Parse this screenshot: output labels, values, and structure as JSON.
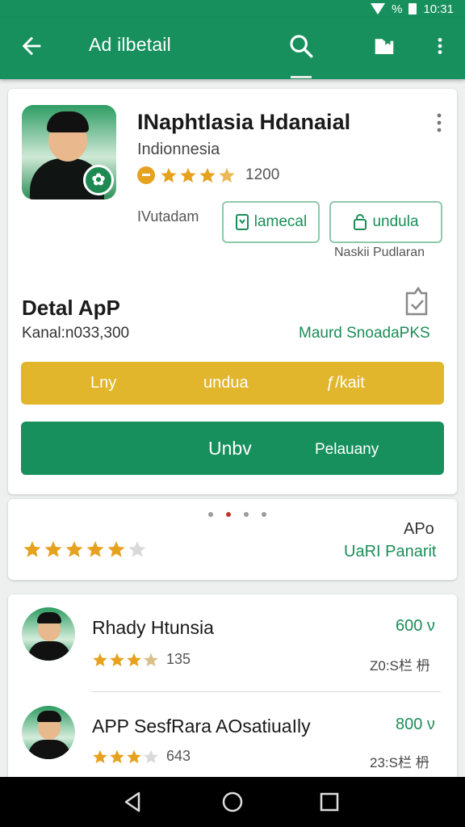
{
  "status_bar": {
    "time": "10:31",
    "battery": "%"
  },
  "app_bar": {
    "title": "Ad ilbetail"
  },
  "app": {
    "title": "INaphtlasia Hdanaial",
    "subtitle": "Indionnesia",
    "rating_count": "1200",
    "publisher": "IVutadam",
    "manage_label": "lamecal",
    "install_label": "undula",
    "helper_text": "Naskii Pudlaran"
  },
  "detail": {
    "title": "Detal ApP",
    "size": "Kanal:n033,300",
    "link": "Maurd SnoadaPKS",
    "gold_bar": {
      "left": "Lny",
      "center": "undua",
      "right": "ƒ/kait"
    },
    "green_bar": {
      "primary": "Unbv",
      "secondary": "Pelauany"
    }
  },
  "rating_card": {
    "label": "APo",
    "link": "UaRI Panarit",
    "stars": 4.5,
    "pager": {
      "count": 4,
      "active": 1
    }
  },
  "list": [
    {
      "name": "Rhady Htunsia",
      "price": "600 ν",
      "rating": 3.5,
      "count": "135",
      "meta": "Z0:S栏 枬"
    },
    {
      "name": "APP SesfRara AOsatiuaIly",
      "price": "800 ν",
      "rating": 3,
      "count": "643",
      "meta": "23:S栏 枬"
    }
  ],
  "colors": {
    "brand_green": "#17905d",
    "gold": "#e1b52c",
    "star": "#e6a21f"
  }
}
